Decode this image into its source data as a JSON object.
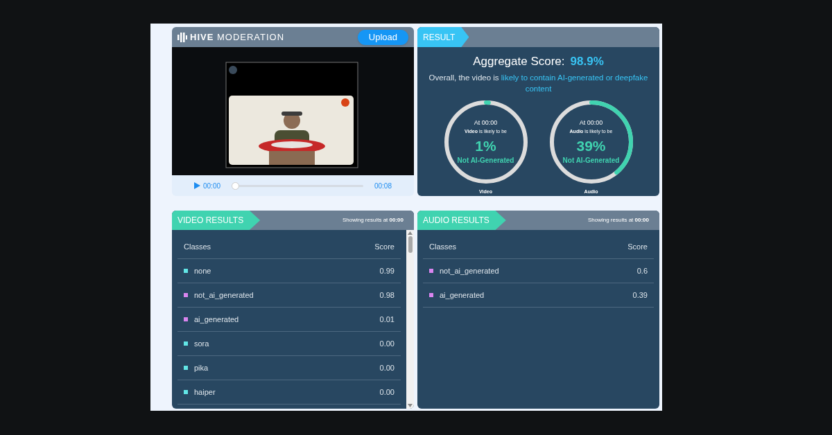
{
  "header": {
    "logo": "**HIVE** MODERATION",
    "upload_button": "Upload"
  },
  "player": {
    "current_time": "00:00",
    "duration": "00:08",
    "level": 0
  },
  "result": {
    "tag": "RESULT",
    "aggregate_label": "Aggregate Score:",
    "aggregate_value": "98.9%",
    "summary_prefix": "Overall, the video is ",
    "summary_highlight": "likely to contain AI-generated or deepfake content",
    "gauges": [
      {
        "time": "At 00:00",
        "subject": "**Video** is likely to be",
        "percent": "1%",
        "verdict": "Not AI-Generated",
        "level": 0.01,
        "caption": "Video"
      },
      {
        "time": "At 00:00",
        "subject": "**Audio** is likely to be",
        "percent": "39%",
        "verdict": "Not AI-Generated",
        "level": 0.39,
        "caption": "Audio"
      }
    ]
  },
  "video_results": {
    "tag": "VIDEO RESULTS",
    "status": "Showing results at **00:00**",
    "columns": [
      "Classes",
      "Score"
    ],
    "rows": [
      {
        "class": "none",
        "score": "0.99",
        "color": "#62e6e6"
      },
      {
        "class": "not_ai_generated",
        "score": "0.98",
        "color": "#d985ef"
      },
      {
        "class": "ai_generated",
        "score": "0.01",
        "color": "#d985ef"
      },
      {
        "class": "sora",
        "score": "0.00",
        "color": "#62e6e6"
      },
      {
        "class": "pika",
        "score": "0.00",
        "color": "#62e6e6"
      },
      {
        "class": "haiper",
        "score": "0.00",
        "color": "#62e6e6"
      }
    ]
  },
  "audio_results": {
    "tag": "AUDIO RESULTS",
    "status": "Showing results at **00:00**",
    "columns": [
      "Classes",
      "Score"
    ],
    "rows": [
      {
        "class": "not_ai_generated",
        "score": "0.6",
        "color": "#d985ef"
      },
      {
        "class": "ai_generated",
        "score": "0.39",
        "color": "#d985ef"
      }
    ]
  }
}
